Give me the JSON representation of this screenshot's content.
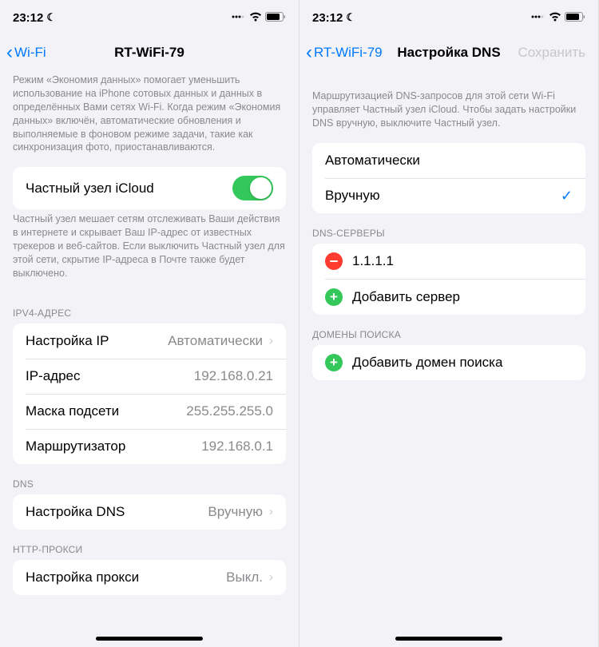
{
  "status": {
    "time": "23:12"
  },
  "left": {
    "back": "Wi-Fi",
    "title": "RT-WiFi-79",
    "note1": "Режим «Экономия данных» помогает уменьшить использование на iPhone сотовых данных и данных в определённых Вами сетях Wi-Fi. Когда режим «Экономия данных» включён, автоматические обновления и выполняемые в фоновом режиме задачи, такие как синхронизация фото, приостанавливаются.",
    "private_label": "Частный узел iCloud",
    "note2": "Частный узел мешает сетям отслеживать Ваши действия в интернете и скрывает Ваш IP-адрес от известных трекеров и веб-сайтов. Если выключить Частный узел для этой сети, скрытие IP-адреса в Почте также будет выключено.",
    "ipv4_header": "IPV4-АДРЕС",
    "ipv4": {
      "configure_label": "Настройка IP",
      "configure_value": "Автоматически",
      "ip_label": "IP-адрес",
      "ip_value": "192.168.0.21",
      "mask_label": "Маска подсети",
      "mask_value": "255.255.255.0",
      "router_label": "Маршрутизатор",
      "router_value": "192.168.0.1"
    },
    "dns_header": "DNS",
    "dns": {
      "label": "Настройка DNS",
      "value": "Вручную"
    },
    "proxy_header": "HTTP-ПРОКСИ",
    "proxy": {
      "label": "Настройка прокси",
      "value": "Выкл."
    }
  },
  "right": {
    "back": "RT-WiFi-79",
    "title": "Настройка DNS",
    "save": "Сохранить",
    "note": "Маршрутизацией DNS-запросов для этой сети Wi-Fi управляет Частный узел iCloud. Чтобы задать настройки DNS вручную, выключите Частный узел.",
    "opt_auto": "Автоматически",
    "opt_manual": "Вручную",
    "dns_servers_header": "DNS-СЕРВЕРЫ",
    "dns_server": "1.1.1.1",
    "add_server": "Добавить сервер",
    "search_header": "ДОМЕНЫ ПОИСКА",
    "add_domain": "Добавить домен поиска"
  }
}
